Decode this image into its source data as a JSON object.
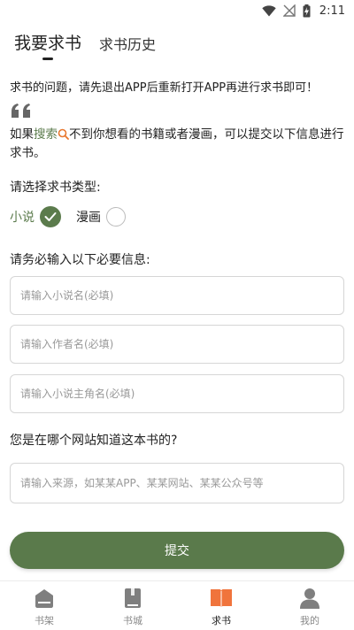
{
  "status_bar": {
    "time": "2:11"
  },
  "tabs": [
    {
      "label": "我要求书",
      "active": true
    },
    {
      "label": "求书历史",
      "active": false
    }
  ],
  "notice": "求书的问题，请先退出APP后重新打开APP再进行求书即可！",
  "info": {
    "prefix": "如果",
    "search_link": "搜索",
    "suffix": "不到你想看的书籍或者漫画，可以提交以下信息进行求书。"
  },
  "type_section": {
    "label": "请选择求书类型:",
    "options": [
      {
        "label": "小说",
        "checked": true
      },
      {
        "label": "漫画",
        "checked": false
      }
    ]
  },
  "required_section": {
    "label": "请务必输入以下必要信息:"
  },
  "fields": {
    "novel_name": {
      "placeholder": "请输入小说名(必填)",
      "value": ""
    },
    "author": {
      "placeholder": "请输入作者名(必填)",
      "value": ""
    },
    "protagonist": {
      "placeholder": "请输入小说主角名(必填)",
      "value": ""
    },
    "source": {
      "placeholder": "请输入来源，如某某APP、某某网站、某某公众号等",
      "value": ""
    }
  },
  "source_section": {
    "label": "您是在哪个网站知道这本书的?"
  },
  "submit_label": "提交",
  "bottom_nav": [
    {
      "label": "书架",
      "icon": "bookshelf-icon",
      "active": false
    },
    {
      "label": "书城",
      "icon": "bookstore-icon",
      "active": false
    },
    {
      "label": "求书",
      "icon": "request-book-icon",
      "active": true
    },
    {
      "label": "我的",
      "icon": "profile-icon",
      "active": false
    }
  ],
  "colors": {
    "accent": "#5a7a4b",
    "active_nav": "#f0743c",
    "inactive_nav": "#7f7f7f"
  }
}
